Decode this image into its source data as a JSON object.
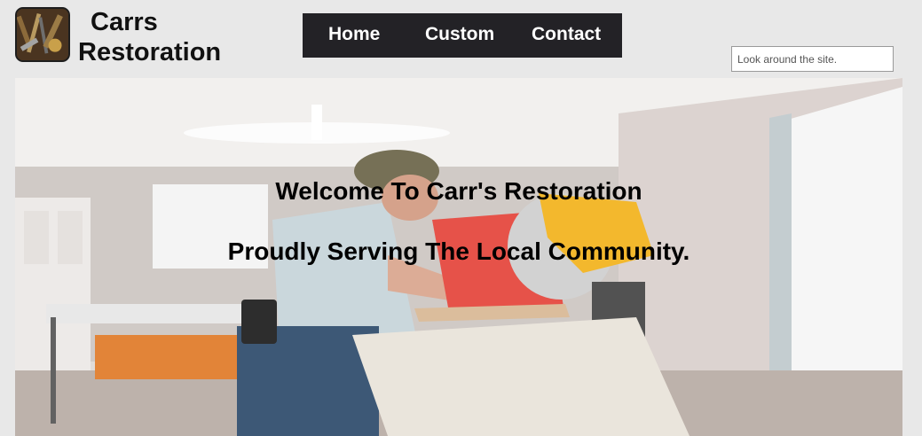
{
  "site": {
    "brand_line1": "Carrs",
    "brand_line2": "Restoration"
  },
  "nav": {
    "items": [
      {
        "label": "Home"
      },
      {
        "label": "Custom"
      },
      {
        "label": "Contact"
      }
    ]
  },
  "search": {
    "placeholder": "Look around the site."
  },
  "hero": {
    "heading": "Welcome To Carr's Restoration",
    "subheading": "Proudly Serving The Local Community."
  },
  "colors": {
    "page_bg": "#e8e8e8",
    "nav_bg": "#232226",
    "nav_text": "#ffffff",
    "accent_saw": "#f2b21c"
  },
  "icons": {
    "logo": "tools-logo-icon"
  }
}
